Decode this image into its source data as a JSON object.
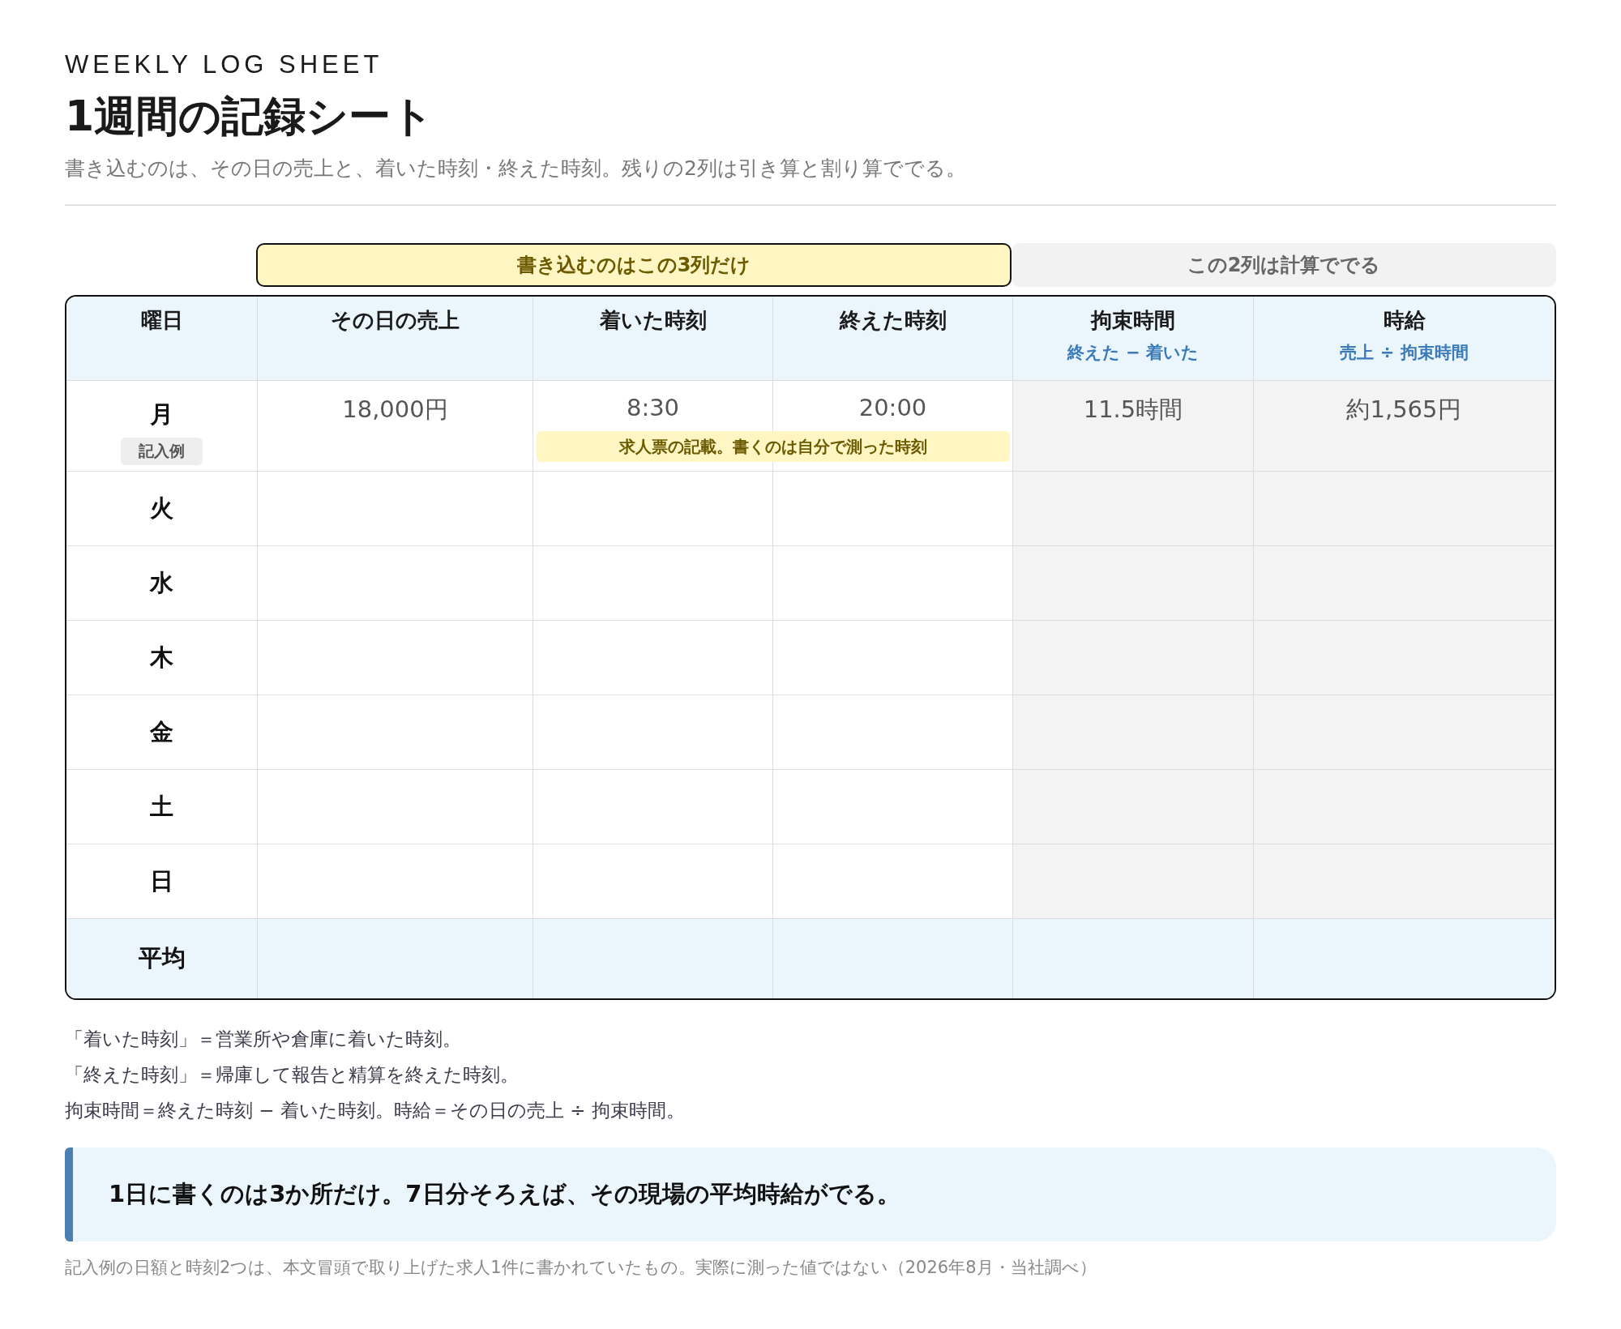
{
  "header": {
    "eyebrow": "WEEKLY LOG SHEET",
    "title": "1週間の記録シート",
    "lead": "書き込むのは、その日の売上と、着いた時刻・終えた時刻。残りの2列は引き算と割り算ででる。"
  },
  "column_groups": [
    {
      "label": "書き込むのはこの3列だけ",
      "kind": "input"
    },
    {
      "label": "この2列は計算ででる",
      "kind": "computed"
    }
  ],
  "table": {
    "columns": [
      {
        "label": "曜日",
        "kind": "day"
      },
      {
        "label": "その日の売上",
        "kind": "input"
      },
      {
        "label": "着いた時刻",
        "kind": "input"
      },
      {
        "label": "終えた時刻",
        "kind": "input"
      },
      {
        "label": "拘束時間",
        "formula": "終えた − 着いた",
        "kind": "computed"
      },
      {
        "label": "時給",
        "formula": "売上 ÷ 拘束時間",
        "kind": "computed"
      }
    ],
    "rows": [
      {
        "day": "月",
        "badge": "記入例",
        "cells": [
          "18,000円",
          "8:30",
          "20:00",
          "11.5時間",
          "約1,565円"
        ],
        "note": "求人票の記載。書くのは自分で測った時刻",
        "kind": "example"
      },
      {
        "day": "火",
        "kind": "day"
      },
      {
        "day": "水",
        "kind": "day"
      },
      {
        "day": "木",
        "kind": "day"
      },
      {
        "day": "金",
        "kind": "day"
      },
      {
        "day": "土",
        "kind": "day"
      },
      {
        "day": "日",
        "kind": "day"
      },
      {
        "day": "平均",
        "kind": "average"
      }
    ]
  },
  "notes": [
    "「着いた時刻」＝営業所や倉庫に着いた時刻。",
    "「終えた時刻」＝帰庫して報告と精算を終えた時刻。",
    "拘束時間＝終えた時刻 − 着いた時刻。時給＝その日の売上 ÷ 拘束時間。"
  ],
  "callout": "1日に書くのは3か所だけ。7日分そろえば、その現場の平均時給がでる。",
  "footnote": "記入例の日額と時刻2つは、本文冒頭で取り上げた求人1件に書かれていたもの。実際に測った値ではない（2026年8月・当社調べ）"
}
